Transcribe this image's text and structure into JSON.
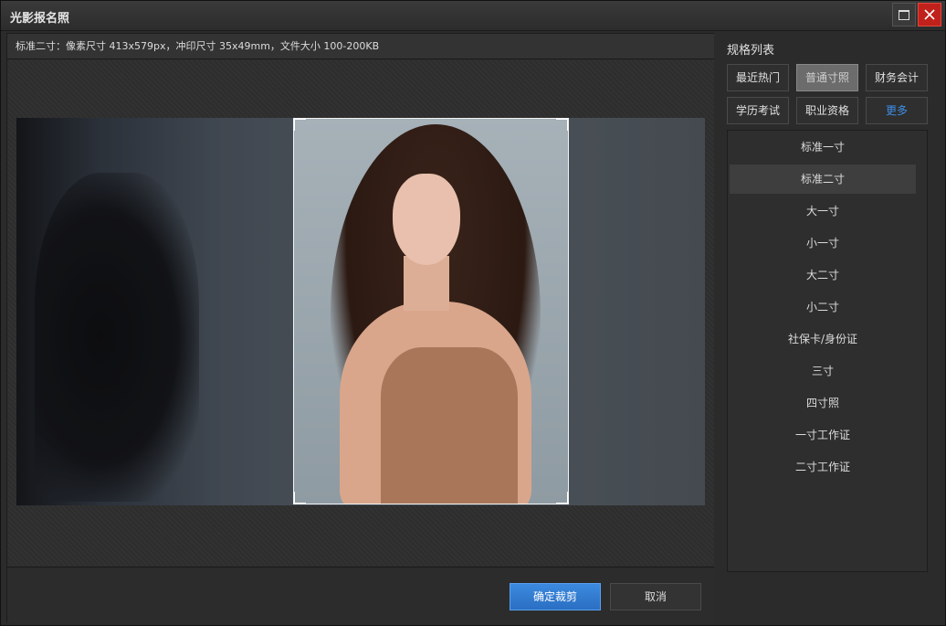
{
  "window": {
    "title": "光影报名照"
  },
  "info": {
    "text": "标准二寸：像素尺寸 413x579px，冲印尺寸 35x49mm，文件大小 100-200KB"
  },
  "footer": {
    "confirm_label": "确定裁剪",
    "cancel_label": "取消"
  },
  "sidebar": {
    "title": "规格列表",
    "categories": [
      "最近热门",
      "普通寸照",
      "财务会计",
      "学历考试",
      "职业资格",
      "更多"
    ],
    "active_category": "普通寸照",
    "items": [
      "标准一寸",
      "标准二寸",
      "大一寸",
      "小一寸",
      "大二寸",
      "小二寸",
      "社保卡/身份证",
      "三寸",
      "四寸照",
      "一寸工作证",
      "二寸工作证"
    ],
    "selected_item": "标准二寸"
  },
  "colors": {
    "accent": "#2a6fc2",
    "more_link": "#3d8fe8",
    "close_button": "#c0221b"
  }
}
